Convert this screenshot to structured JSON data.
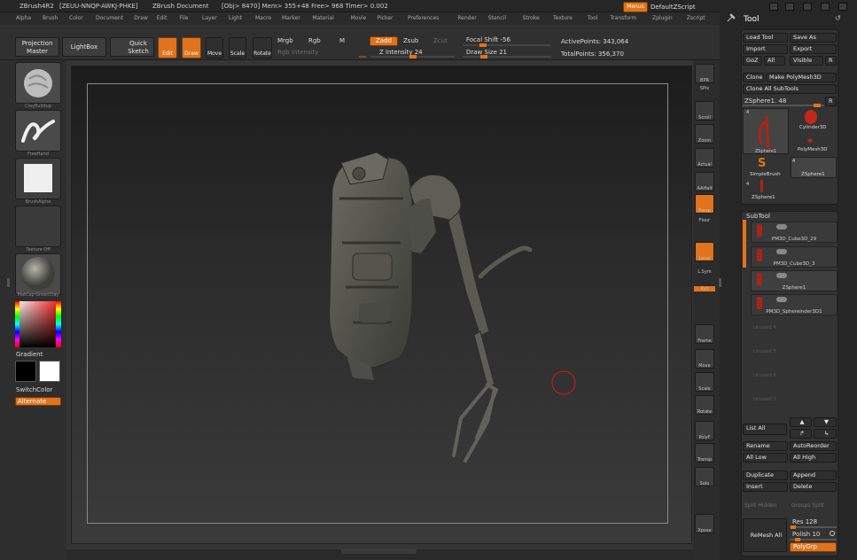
{
  "titlebar": {
    "app": "ZBrush4R2",
    "serial": "[ZEUU-NNQP-AWKJ-PHKE]",
    "doc": "ZBrush Document",
    "stats": "[Obj> 8470]  Mem> 355+48  Free> 968  Timer> 0.002",
    "menus_label": "Menus",
    "script_label": "DefaultZScript"
  },
  "menubar": [
    "Alpha",
    "Brush",
    "Color",
    "Document",
    "Draw",
    "Edit",
    "File",
    "Layer",
    "Light",
    "Macro",
    "Marker",
    "Material",
    "Movie",
    "Picker",
    "Preferences",
    "Render",
    "Stencil",
    "Stroke",
    "Texture",
    "Tool",
    "Transform",
    "Zplugin",
    "Zscript"
  ],
  "shelf": {
    "projection": "Projection\nMaster",
    "lightbox": "LightBox",
    "quicksketch": "Quick\nSketch",
    "edit": "Edit",
    "draw": "Draw",
    "move": "Move",
    "scale": "Scale",
    "rotate": "Rotate",
    "mrgb": "Mrgb",
    "rgb": "Rgb",
    "m": "M",
    "zadd": "Zadd",
    "zsub": "Zsub",
    "zcut": "Zcut",
    "rgb_intensity": "Rgb Intensity",
    "z_intensity": "Z Intensity 24",
    "focal_shift": "Focal Shift -56",
    "draw_size": "Draw Size 21",
    "active_points": "ActivePoints: 343,064",
    "total_points": "TotalPoints: 356,370"
  },
  "leftbar": {
    "brush": "ClayBuildup",
    "stroke": "FreeHand",
    "alpha": "BrushAlpha",
    "texture": "Texture Off",
    "material": "MatCap GreenClay",
    "gradient": "Gradient",
    "switchcolor": "SwitchColor",
    "alternate": "Alternate"
  },
  "rightshelf": [
    "BPR",
    "SPix",
    "Scroll",
    "Zoom",
    "Actual",
    "AAHalf",
    "Persp",
    "Floor",
    "Local",
    "L.Sym",
    "Xyz",
    "Frame",
    "Move",
    "Scale",
    "Rotate",
    "PolyF",
    "Transp",
    "Solo",
    "Xpose"
  ],
  "tool": {
    "title": "Tool",
    "load_tool": "Load Tool",
    "save_as": "Save As",
    "import": "Import",
    "export": "Export",
    "goz": "GoZ",
    "all": "All",
    "visible": "Visible",
    "r": "R",
    "clone": "Clone",
    "make_polymesh": "Make PolyMesh3D",
    "clone_all": "Clone All SubTools",
    "current_tool": "ZSphere1. 48",
    "tools": [
      {
        "name": "ZSphere1",
        "count": "4"
      },
      {
        "name": "Cylinder3D",
        "count": ""
      },
      {
        "name": "PolyMesh3D",
        "count": ""
      },
      {
        "name": "SimpleBrush",
        "count": ""
      },
      {
        "name": "ZSphere1",
        "count": "4"
      },
      {
        "name": "ZSphere1",
        "count": "4"
      }
    ]
  },
  "subtool": {
    "title": "SubTool",
    "items": [
      "PM3D_Cube3D_29",
      "PM3D_Cube3D_3",
      "ZSphere1",
      "PM3D_Sphereinder3D1"
    ],
    "unused": [
      "Unused 4",
      "Unused 5",
      "Unused 6",
      "Unused 7"
    ],
    "list_all": "List All",
    "rename": "Rename",
    "autoreorder": "AutoReorder",
    "all_low": "All Low",
    "all_high": "All High",
    "duplicate": "Duplicate",
    "append": "Append",
    "insert": "Insert",
    "delete": "Delete",
    "split_hidden": "Split Hidden",
    "groups_split": "Groups Split",
    "res": "Res 128",
    "remesh_all": "ReMesh All",
    "polish": "Polish 10",
    "polygrp": "PolyGrp"
  },
  "colors": {
    "accent": "#e0731b",
    "panel": "#333333",
    "canvas_top": "#1c1c1c"
  }
}
